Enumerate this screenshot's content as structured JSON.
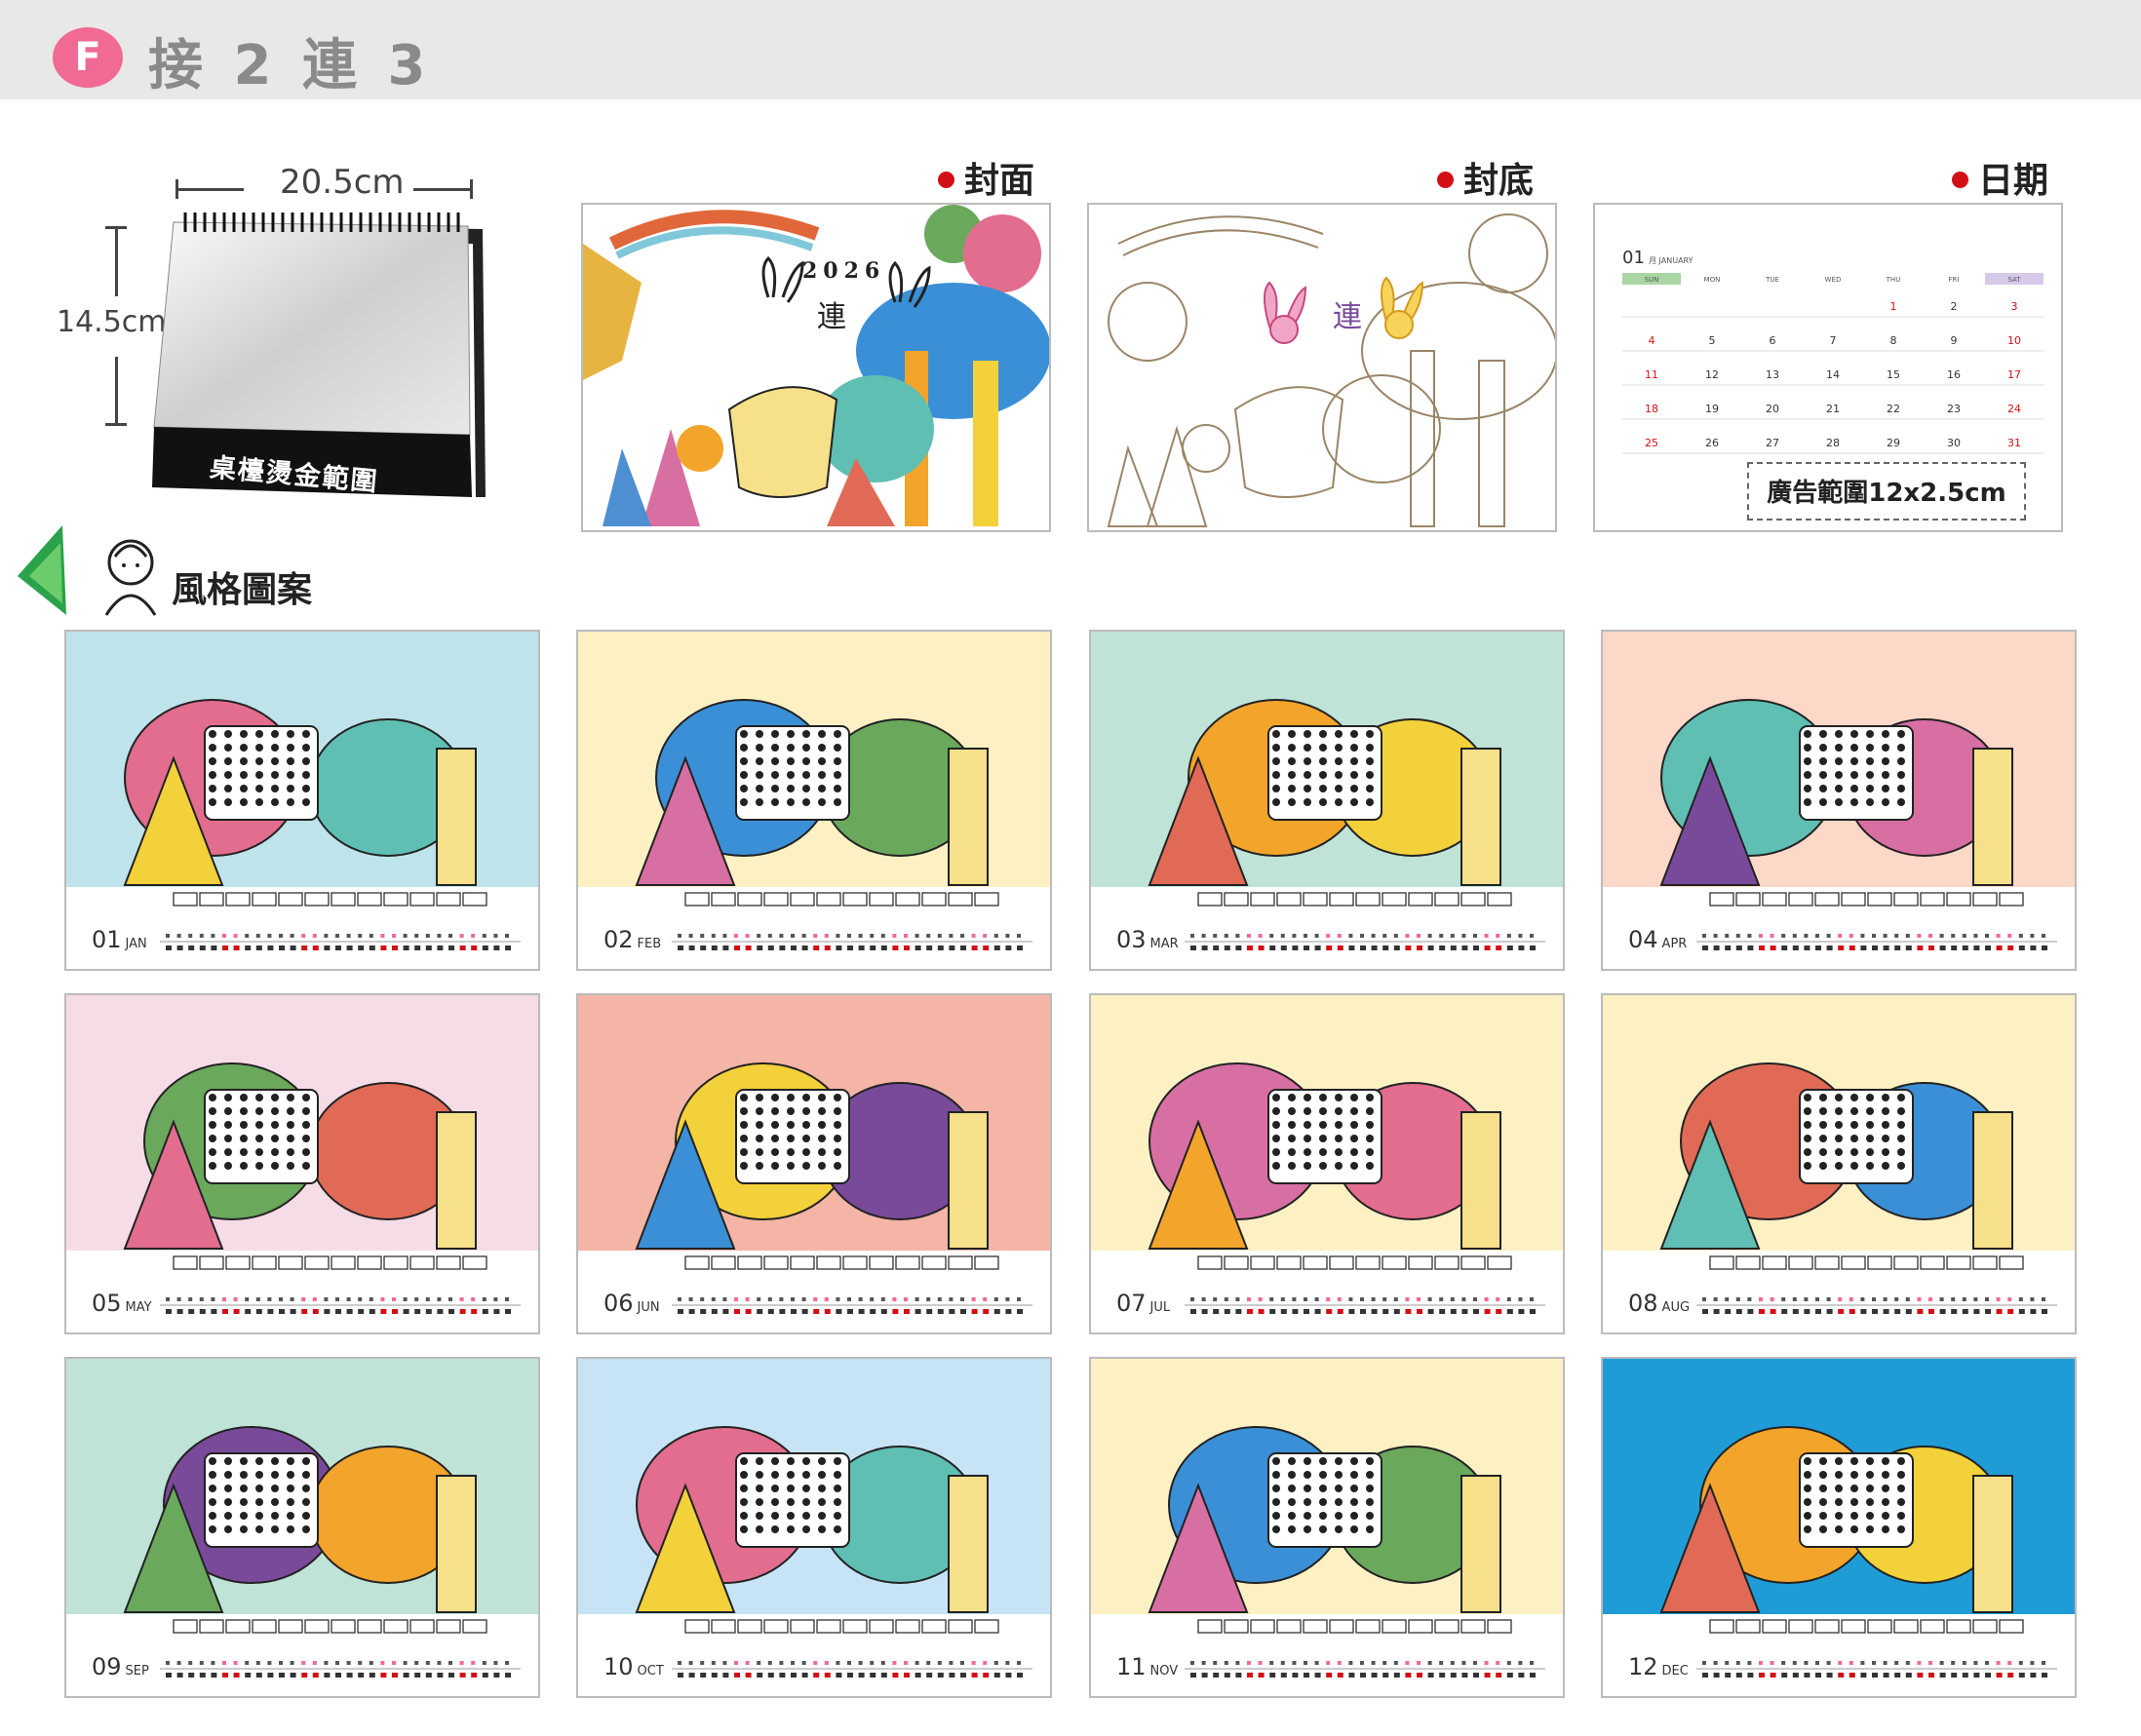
{
  "header": {
    "badge": "F",
    "title": "接 2 連 3"
  },
  "product": {
    "width_label": "20.5cm",
    "height_label": "14.5cm",
    "band_text": "桌檯燙金範圍"
  },
  "previews": [
    {
      "label": "封面"
    },
    {
      "label": "封底"
    },
    {
      "label": "日期"
    }
  ],
  "cover_year": "2026",
  "date_sheet": {
    "month_num": "01",
    "month_name": "月 JANUARY",
    "weekdays": [
      "SUN",
      "MON",
      "TUE",
      "WED",
      "THU",
      "FRI",
      "SAT"
    ],
    "ad_label": "廣告範圍12x2.5cm"
  },
  "style_section": {
    "label": "風格圖案"
  },
  "months": [
    {
      "num": "01",
      "abbr": "JAN",
      "bg": "#bfe3ea"
    },
    {
      "num": "02",
      "abbr": "FEB",
      "bg": "#fdf1c4"
    },
    {
      "num": "03",
      "abbr": "MAR",
      "bg": "#bfe3d6"
    },
    {
      "num": "04",
      "abbr": "APR",
      "bg": "#fbd8c8"
    },
    {
      "num": "05",
      "abbr": "MAY",
      "bg": "#f6dce7"
    },
    {
      "num": "06",
      "abbr": "JUN",
      "bg": "#f4b4a6"
    },
    {
      "num": "07",
      "abbr": "JUL",
      "bg": "#fdf1c4"
    },
    {
      "num": "08",
      "abbr": "AUG",
      "bg": "#fdf1c4"
    },
    {
      "num": "09",
      "abbr": "SEP",
      "bg": "#bfe3d6"
    },
    {
      "num": "10",
      "abbr": "OCT",
      "bg": "#c6e4f5"
    },
    {
      "num": "11",
      "abbr": "NOV",
      "bg": "#fdf1c4"
    },
    {
      "num": "12",
      "abbr": "DEC",
      "bg": "#1f9cd6"
    }
  ],
  "colors": {
    "accent": "#f06a93",
    "dot": "#d20f14",
    "header_bg": "#e8e8e8"
  }
}
